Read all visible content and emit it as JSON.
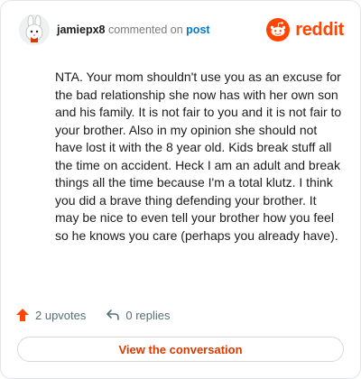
{
  "header": {
    "username": "jamiepx8",
    "action_text": "commented on",
    "post_link": "post",
    "brand": "reddit"
  },
  "comment": {
    "text": "NTA. Your mom shouldn't use you as an excuse for the bad relationship she now has with her own son and his family. It is not fair to you and it is not fair to your brother. Also in my opinion she should not have lost it with the 8 year old. Kids break stuff all the time on accident. Heck I am an adult and break things all the time because I'm a total klutz. I think you did a brave thing defending your brother. It may be nice to even tell your brother how you feel so he knows you care (perhaps you already have)."
  },
  "actions": {
    "upvotes": "2 upvotes",
    "replies": "0 replies"
  },
  "footer": {
    "view_button": "View the conversation"
  },
  "colors": {
    "brand": "#ff4500",
    "link": "#0079d3",
    "button_text": "#d93a00"
  }
}
